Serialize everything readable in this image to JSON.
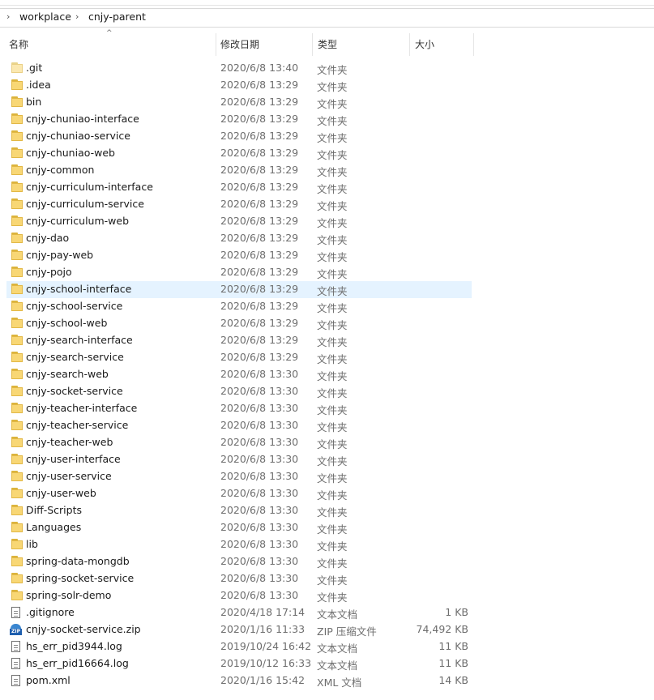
{
  "breadcrumb": {
    "items": [
      "workplace",
      "cnjy-parent"
    ],
    "separator": "›"
  },
  "columns": {
    "name": "名称",
    "date": "修改日期",
    "type": "类型",
    "size": "大小"
  },
  "files": [
    {
      "name": ".git",
      "date": "2020/6/8 13:40",
      "type": "文件夹",
      "size": "",
      "icon": "folder-icon"
    },
    {
      "name": ".idea",
      "date": "2020/6/8 13:29",
      "type": "文件夹",
      "size": "",
      "icon": "folder-icon"
    },
    {
      "name": "bin",
      "date": "2020/6/8 13:29",
      "type": "文件夹",
      "size": "",
      "icon": "folder-icon"
    },
    {
      "name": "cnjy-chuniao-interface",
      "date": "2020/6/8 13:29",
      "type": "文件夹",
      "size": "",
      "icon": "folder-icon"
    },
    {
      "name": "cnjy-chuniao-service",
      "date": "2020/6/8 13:29",
      "type": "文件夹",
      "size": "",
      "icon": "folder-icon"
    },
    {
      "name": "cnjy-chuniao-web",
      "date": "2020/6/8 13:29",
      "type": "文件夹",
      "size": "",
      "icon": "folder-icon"
    },
    {
      "name": "cnjy-common",
      "date": "2020/6/8 13:29",
      "type": "文件夹",
      "size": "",
      "icon": "folder-icon"
    },
    {
      "name": "cnjy-curriculum-interface",
      "date": "2020/6/8 13:29",
      "type": "文件夹",
      "size": "",
      "icon": "folder-icon"
    },
    {
      "name": "cnjy-curriculum-service",
      "date": "2020/6/8 13:29",
      "type": "文件夹",
      "size": "",
      "icon": "folder-icon"
    },
    {
      "name": "cnjy-curriculum-web",
      "date": "2020/6/8 13:29",
      "type": "文件夹",
      "size": "",
      "icon": "folder-icon"
    },
    {
      "name": "cnjy-dao",
      "date": "2020/6/8 13:29",
      "type": "文件夹",
      "size": "",
      "icon": "folder-icon"
    },
    {
      "name": "cnjy-pay-web",
      "date": "2020/6/8 13:29",
      "type": "文件夹",
      "size": "",
      "icon": "folder-icon"
    },
    {
      "name": "cnjy-pojo",
      "date": "2020/6/8 13:29",
      "type": "文件夹",
      "size": "",
      "icon": "folder-icon"
    },
    {
      "name": "cnjy-school-interface",
      "date": "2020/6/8 13:29",
      "type": "文件夹",
      "size": "",
      "icon": "folder-icon",
      "selected": true
    },
    {
      "name": "cnjy-school-service",
      "date": "2020/6/8 13:29",
      "type": "文件夹",
      "size": "",
      "icon": "folder-icon"
    },
    {
      "name": "cnjy-school-web",
      "date": "2020/6/8 13:29",
      "type": "文件夹",
      "size": "",
      "icon": "folder-icon"
    },
    {
      "name": "cnjy-search-interface",
      "date": "2020/6/8 13:29",
      "type": "文件夹",
      "size": "",
      "icon": "folder-icon"
    },
    {
      "name": "cnjy-search-service",
      "date": "2020/6/8 13:29",
      "type": "文件夹",
      "size": "",
      "icon": "folder-icon"
    },
    {
      "name": "cnjy-search-web",
      "date": "2020/6/8 13:30",
      "type": "文件夹",
      "size": "",
      "icon": "folder-icon"
    },
    {
      "name": "cnjy-socket-service",
      "date": "2020/6/8 13:30",
      "type": "文件夹",
      "size": "",
      "icon": "folder-icon"
    },
    {
      "name": "cnjy-teacher-interface",
      "date": "2020/6/8 13:30",
      "type": "文件夹",
      "size": "",
      "icon": "folder-icon"
    },
    {
      "name": "cnjy-teacher-service",
      "date": "2020/6/8 13:30",
      "type": "文件夹",
      "size": "",
      "icon": "folder-icon"
    },
    {
      "name": "cnjy-teacher-web",
      "date": "2020/6/8 13:30",
      "type": "文件夹",
      "size": "",
      "icon": "folder-icon"
    },
    {
      "name": "cnjy-user-interface",
      "date": "2020/6/8 13:30",
      "type": "文件夹",
      "size": "",
      "icon": "folder-icon"
    },
    {
      "name": "cnjy-user-service",
      "date": "2020/6/8 13:30",
      "type": "文件夹",
      "size": "",
      "icon": "folder-icon"
    },
    {
      "name": "cnjy-user-web",
      "date": "2020/6/8 13:30",
      "type": "文件夹",
      "size": "",
      "icon": "folder-icon"
    },
    {
      "name": "Diff-Scripts",
      "date": "2020/6/8 13:30",
      "type": "文件夹",
      "size": "",
      "icon": "folder-icon"
    },
    {
      "name": "Languages",
      "date": "2020/6/8 13:30",
      "type": "文件夹",
      "size": "",
      "icon": "folder-icon"
    },
    {
      "name": "lib",
      "date": "2020/6/8 13:30",
      "type": "文件夹",
      "size": "",
      "icon": "folder-icon"
    },
    {
      "name": "spring-data-mongdb",
      "date": "2020/6/8 13:30",
      "type": "文件夹",
      "size": "",
      "icon": "folder-icon"
    },
    {
      "name": "spring-socket-service",
      "date": "2020/6/8 13:30",
      "type": "文件夹",
      "size": "",
      "icon": "folder-icon"
    },
    {
      "name": "spring-solr-demo",
      "date": "2020/6/8 13:30",
      "type": "文件夹",
      "size": "",
      "icon": "folder-icon"
    },
    {
      "name": ".gitignore",
      "date": "2020/4/18 17:14",
      "type": "文本文档",
      "size": "1 KB",
      "icon": "text-file-icon"
    },
    {
      "name": "cnjy-socket-service.zip",
      "date": "2020/1/16 11:33",
      "type": "ZIP 压缩文件",
      "size": "74,492 KB",
      "icon": "zip-file-icon"
    },
    {
      "name": "hs_err_pid3944.log",
      "date": "2019/10/24 16:42",
      "type": "文本文档",
      "size": "11 KB",
      "icon": "text-file-icon"
    },
    {
      "name": "hs_err_pid16664.log",
      "date": "2019/10/12 16:33",
      "type": "文本文档",
      "size": "11 KB",
      "icon": "text-file-icon"
    },
    {
      "name": "pom.xml",
      "date": "2020/1/16 15:42",
      "type": "XML 文档",
      "size": "14 KB",
      "icon": "xml-file-icon"
    }
  ]
}
